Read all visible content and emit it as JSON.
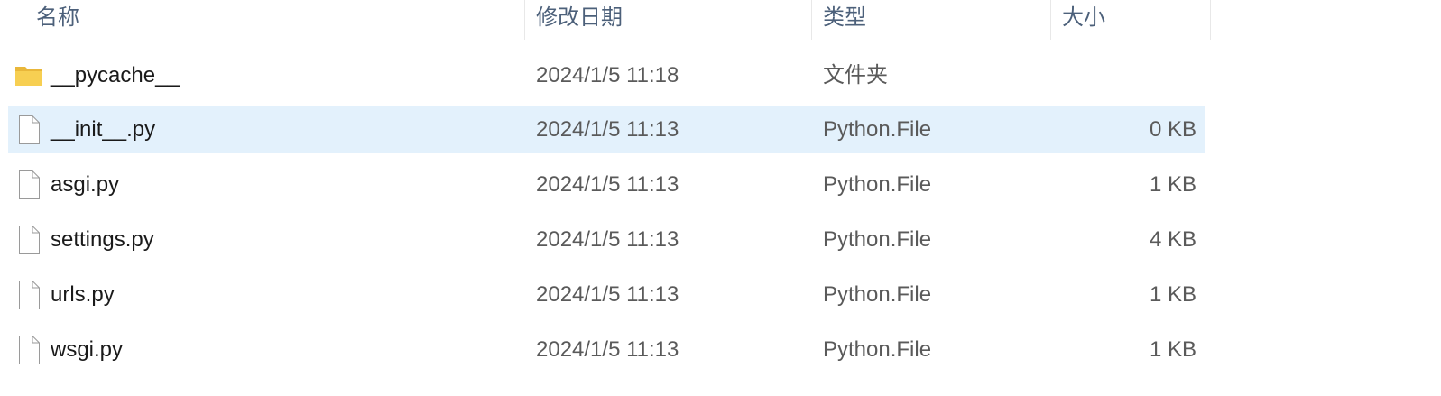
{
  "columns": {
    "name": "名称",
    "date": "修改日期",
    "type": "类型",
    "size": "大小"
  },
  "files": [
    {
      "name": "__pycache__",
      "date": "2024/1/5 11:18",
      "type": "文件夹",
      "size": "",
      "icon": "folder-icon",
      "selected": false
    },
    {
      "name": "__init__.py",
      "date": "2024/1/5 11:13",
      "type": "Python.File",
      "size": "0 KB",
      "icon": "file-icon",
      "selected": true
    },
    {
      "name": "asgi.py",
      "date": "2024/1/5 11:13",
      "type": "Python.File",
      "size": "1 KB",
      "icon": "file-icon",
      "selected": false
    },
    {
      "name": "settings.py",
      "date": "2024/1/5 11:13",
      "type": "Python.File",
      "size": "4 KB",
      "icon": "file-icon",
      "selected": false
    },
    {
      "name": "urls.py",
      "date": "2024/1/5 11:13",
      "type": "Python.File",
      "size": "1 KB",
      "icon": "file-icon",
      "selected": false
    },
    {
      "name": "wsgi.py",
      "date": "2024/1/5 11:13",
      "type": "Python.File",
      "size": "1 KB",
      "icon": "file-icon",
      "selected": false
    }
  ],
  "colors": {
    "selected_row": "#e3f1fc",
    "folder": "#f5c842",
    "header_text": "#4c607a"
  }
}
